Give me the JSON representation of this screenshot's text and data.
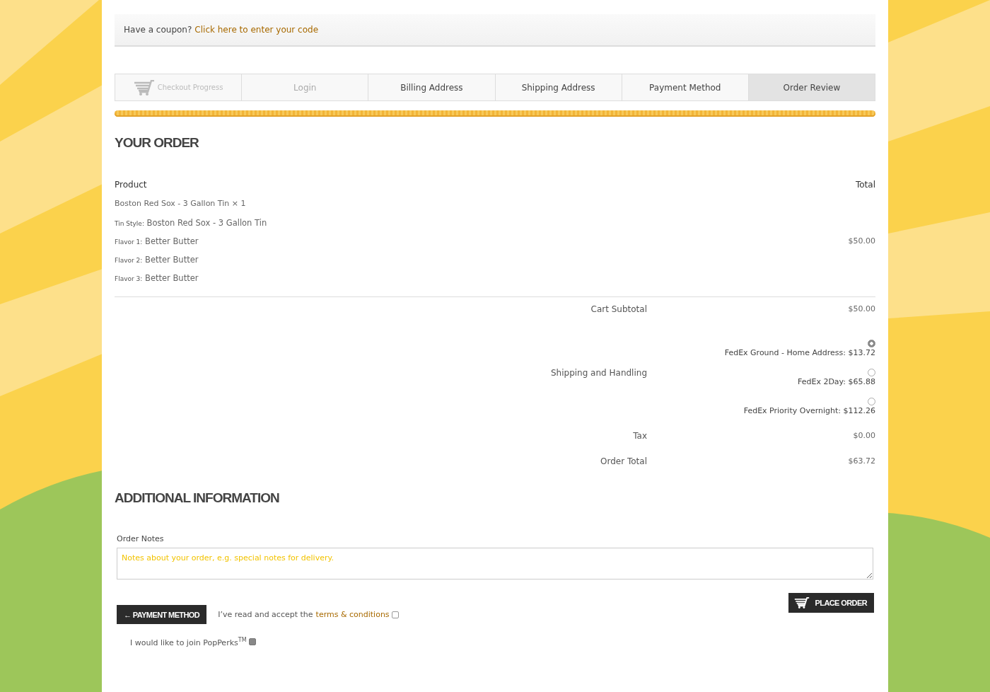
{
  "coupon": {
    "text": "Have a coupon?",
    "link": "Click here to enter your code"
  },
  "checkout_progress_label": "Checkout Progress",
  "checkout_steps": [
    {
      "label": "Login",
      "disabled": true,
      "selected": false
    },
    {
      "label": "Billing Address",
      "disabled": false,
      "selected": false
    },
    {
      "label": "Shipping Address",
      "disabled": false,
      "selected": false
    },
    {
      "label": "Payment Method",
      "disabled": false,
      "selected": false
    },
    {
      "label": "Order Review",
      "disabled": false,
      "selected": true
    }
  ],
  "progress": {
    "level": 1
  },
  "your_order": {
    "title": "YOUR ORDER",
    "columns": [
      "Product",
      "Total"
    ],
    "product": {
      "name": "Boston Red Sox - 3 Gallon Tin × 1",
      "total": "$50.00",
      "details": [
        {
          "label": "Tin Style:",
          "value": "Boston Red Sox - 3 Gallon Tin"
        },
        {
          "label": "Flavor 1:",
          "value": "Better Butter"
        },
        {
          "label": "Flavor 2:",
          "value": "Better Butter"
        },
        {
          "label": "Flavor 3:",
          "value": "Better Butter"
        }
      ]
    },
    "totals": [
      {
        "kind": "amount",
        "label": "Cart Subtotal",
        "value": "$50.00"
      },
      {
        "kind": "shipping",
        "label": "Shipping and Handling",
        "options": [
          {
            "label": "FedEx Ground - Home Address: $13.72",
            "selected": true
          },
          {
            "label": "FedEx 2Day: $65.88",
            "selected": false
          },
          {
            "label": "FedEx Priority Overnight: $112.26",
            "selected": false
          }
        ]
      },
      {
        "kind": "amount",
        "label": "Tax",
        "value": "$0.00"
      },
      {
        "kind": "amount",
        "label": "Order Total",
        "value": "$63.72"
      }
    ]
  },
  "additional_information": {
    "title": "ADDITIONAL INFORMATION",
    "notes_label": "Order Notes",
    "notes_placeholder": "Notes about your order, e.g. special notes for delivery."
  },
  "back_button": "← PAYMENT METHOD",
  "terms": {
    "text": "I’ve read and accept the",
    "link": "terms & conditions",
    "checked": false
  },
  "place_order_button": "PLACE ORDER",
  "popperks": {
    "text": "I would like to join PopPerks$^{TM}$",
    "checked": true
  }
}
